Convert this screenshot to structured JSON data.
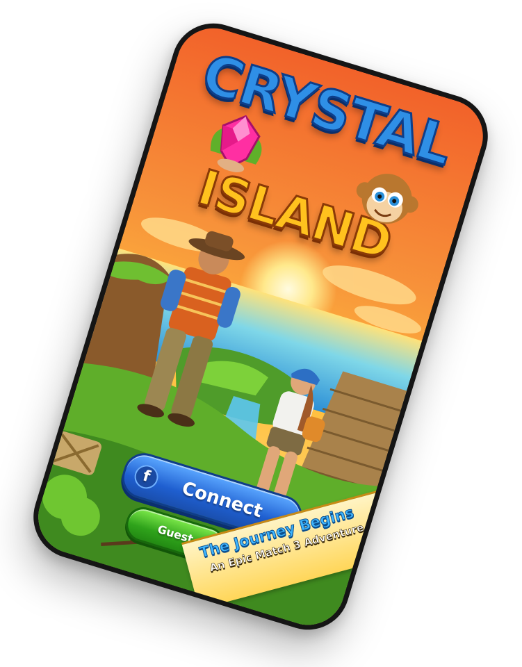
{
  "game": {
    "title_line1": "CRYSTAL",
    "title_line2": "ISLAND"
  },
  "login": {
    "facebook_icon": "f",
    "connect_label": "Connect",
    "guest_label": "Guest"
  },
  "banner": {
    "title": "The Journey Begins",
    "subtitle": "An Epic Match 3 Adventure"
  },
  "icons": {
    "facebook": "facebook-icon",
    "gem": "gem-icon",
    "monkey": "monkey-icon"
  },
  "colors": {
    "sky_top": "#f2622a",
    "sky_mid": "#ffbe3d",
    "sea": "#3fb6e8",
    "grass": "#5fae2a",
    "connect_button": "#1f5fd0",
    "guest_button": "#2fa31b",
    "title_blue": "#2f8fe6",
    "title_gold": "#ffc21e",
    "banner": "#ffd659"
  }
}
